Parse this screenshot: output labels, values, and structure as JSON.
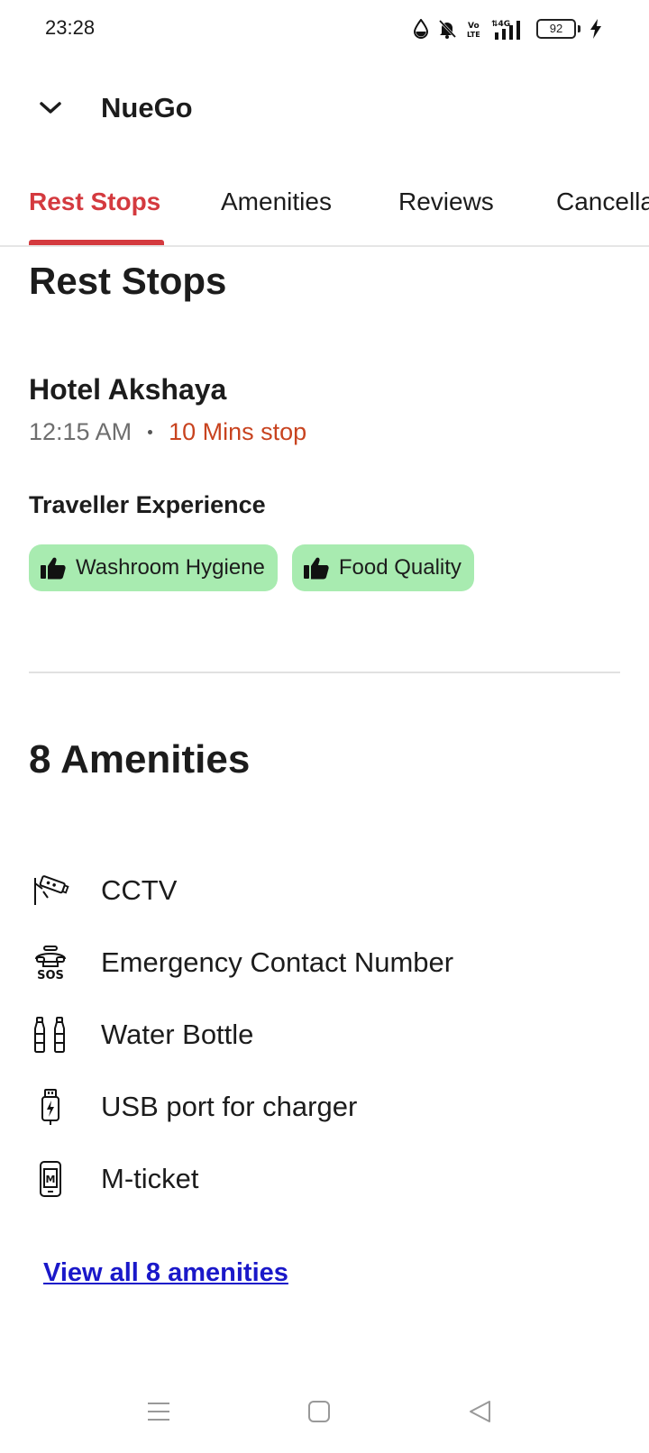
{
  "status_bar": {
    "time": "23:28",
    "battery": "92"
  },
  "header": {
    "title": "NueGo"
  },
  "tabs": [
    {
      "label": "Rest Stops"
    },
    {
      "label": "Amenities"
    },
    {
      "label": "Reviews"
    },
    {
      "label": "Cancella"
    }
  ],
  "rest_stops": {
    "title": "Rest Stops",
    "hotel_name": "Hotel Akshaya",
    "time": "12:15 AM",
    "stop_duration": "10 Mins stop",
    "experience_label": "Traveller Experience",
    "chips": [
      {
        "label": "Washroom Hygiene",
        "icon": "thumbs-up-icon"
      },
      {
        "label": "Food Quality",
        "icon": "thumbs-up-icon"
      }
    ]
  },
  "amenities": {
    "title": "8 Amenities",
    "items": [
      {
        "label": "CCTV",
        "icon": "cctv-icon"
      },
      {
        "label": "Emergency Contact Number",
        "icon": "sos-icon"
      },
      {
        "label": "Water Bottle",
        "icon": "water-bottle-icon"
      },
      {
        "label": "USB port for charger",
        "icon": "usb-charger-icon"
      },
      {
        "label": "M-ticket",
        "icon": "m-ticket-icon"
      }
    ],
    "view_all": "View all 8 amenities"
  },
  "colors": {
    "accent": "#d43a3f",
    "stop_text": "#c8431f",
    "chip_bg": "#a8ebb0",
    "link": "#1a18c9"
  }
}
